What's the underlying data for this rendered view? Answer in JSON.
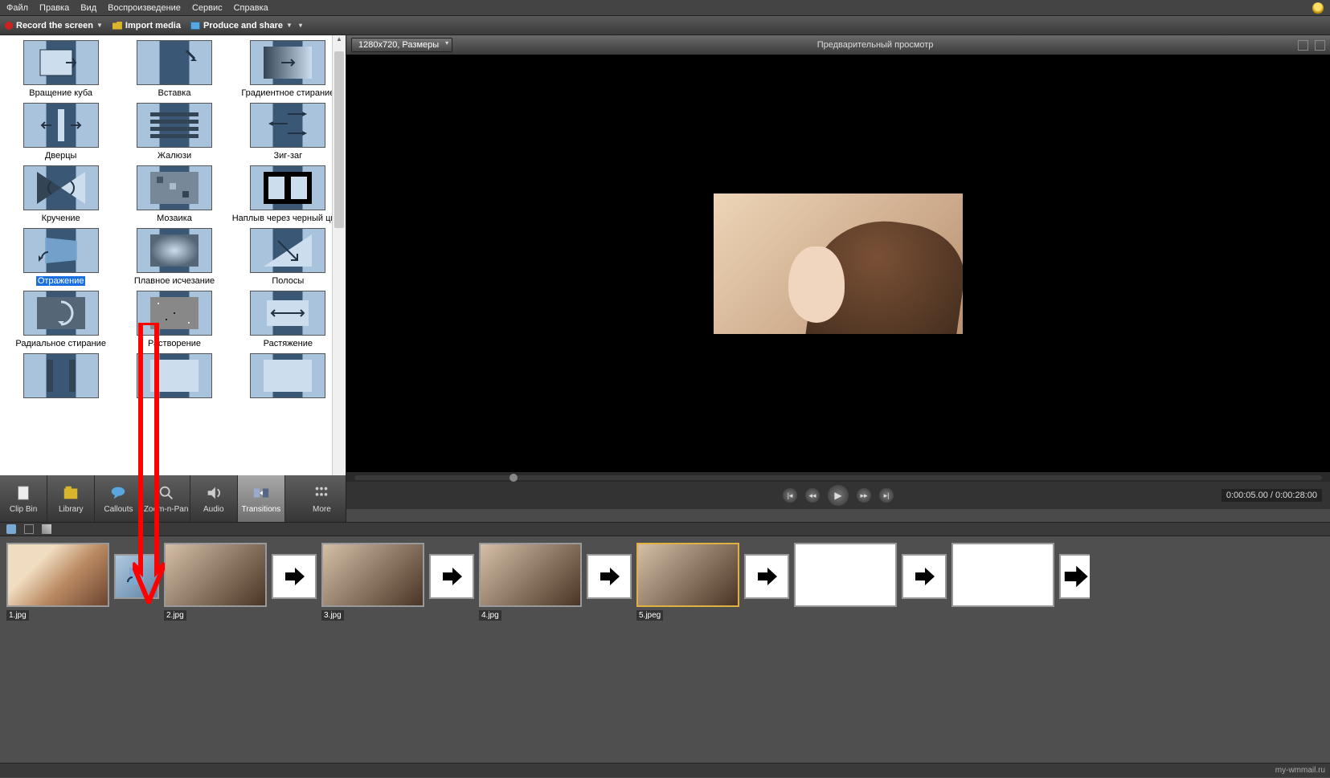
{
  "menu": [
    "Файл",
    "Правка",
    "Вид",
    "Воспроизведение",
    "Сервис",
    "Справка"
  ],
  "actions": {
    "record": "Record the screen",
    "import": "Import media",
    "produce": "Produce and share"
  },
  "transitions": [
    {
      "label": "Вращение куба"
    },
    {
      "label": "Вставка"
    },
    {
      "label": "Градиентное стирание"
    },
    {
      "label": "Дверцы"
    },
    {
      "label": "Жалюзи"
    },
    {
      "label": "Зиг-заг"
    },
    {
      "label": "Кручение"
    },
    {
      "label": "Мозаика"
    },
    {
      "label": "Наплыв через черный цвет"
    },
    {
      "label": "Отражение",
      "selected": true
    },
    {
      "label": "Плавное исчезание"
    },
    {
      "label": "Полосы"
    },
    {
      "label": "Радиальное стирание"
    },
    {
      "label": "Растворение"
    },
    {
      "label": "Растяжение"
    },
    {
      "label": ""
    },
    {
      "label": ""
    },
    {
      "label": ""
    }
  ],
  "tabs": [
    {
      "label": "Clip Bin",
      "icon": "page"
    },
    {
      "label": "Library",
      "icon": "library"
    },
    {
      "label": "Callouts",
      "icon": "callout"
    },
    {
      "label": "Zoom-n-Pan",
      "icon": "zoom"
    },
    {
      "label": "Audio",
      "icon": "audio"
    },
    {
      "label": "Transitions",
      "icon": "transition",
      "selected": true
    },
    {
      "label": "More",
      "icon": "more"
    }
  ],
  "preview": {
    "dimensions": "1280x720, Размеры",
    "title": "Предварительный просмотр",
    "time": "0:00:05.00 / 0:00:28:00"
  },
  "timeline": {
    "clips": [
      {
        "name": "1.jpg"
      },
      {
        "name": "2.jpg"
      },
      {
        "name": "3.jpg"
      },
      {
        "name": "4.jpg"
      },
      {
        "name": "5.jpeg",
        "selected": true
      },
      {
        "name": ""
      },
      {
        "name": ""
      }
    ]
  },
  "footer": "my-wmmail.ru"
}
